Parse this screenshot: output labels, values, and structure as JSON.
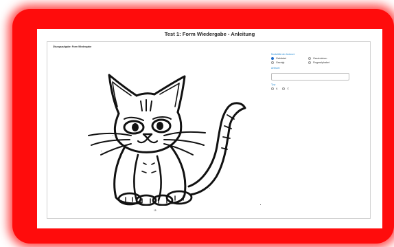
{
  "app": {
    "title": "Test 1: Form Wiedergabe - Anleitung"
  },
  "panel": {
    "exercise_label": "Übungsaufgabe: Form Wiedergabe",
    "page_number": "15"
  },
  "form": {
    "modality_label": "Modalität der Antwort:",
    "modality_options": [
      {
        "label": "Gebärdet",
        "selected": true
      },
      {
        "label": "Geschrieben",
        "selected": false
      },
      {
        "label": "Gezeigt",
        "selected": false
      },
      {
        "label": "Fingeralphabet",
        "selected": false
      }
    ],
    "answer_label": "Antwort:",
    "answer_value": "",
    "type_label": "Typ:",
    "type_options": [
      {
        "label": "A",
        "selected": false
      },
      {
        "label": "C",
        "selected": false
      }
    ]
  },
  "colors": {
    "frame": "#ff0c0c",
    "accent": "#2b8fd6",
    "selected": "#1e6ecf"
  },
  "image": {
    "subject": "cat line drawing"
  }
}
